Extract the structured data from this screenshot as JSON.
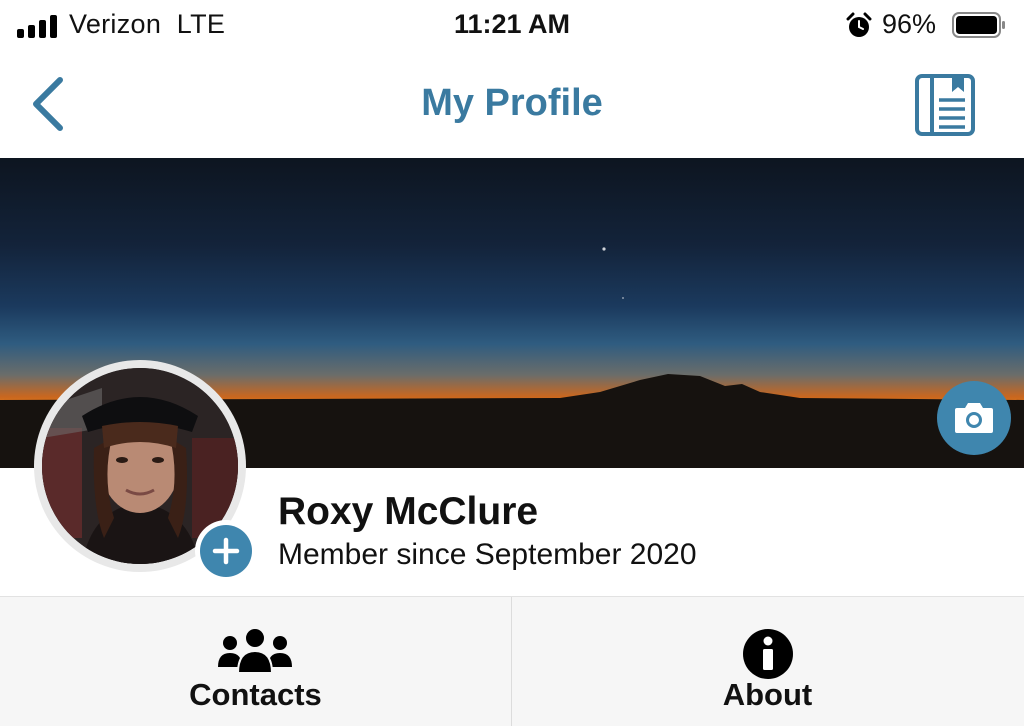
{
  "status_bar": {
    "carrier": "Verizon  LTE",
    "time": "11:21 AM",
    "battery_percent": "96%",
    "signal_bars": 4,
    "battery_level": 0.96
  },
  "nav": {
    "title": "My Profile",
    "back_icon": "chevron-left-icon",
    "right_icon": "notebook-icon"
  },
  "profile": {
    "name": "Roxy McClure",
    "member_since": "Member since September 2020"
  },
  "tabs": [
    {
      "label": "Contacts",
      "icon": "contacts-group-icon"
    },
    {
      "label": "About",
      "icon": "info-icon"
    }
  ],
  "colors": {
    "accent": "#3a7aa0",
    "button_blue": "#3f86ae"
  }
}
